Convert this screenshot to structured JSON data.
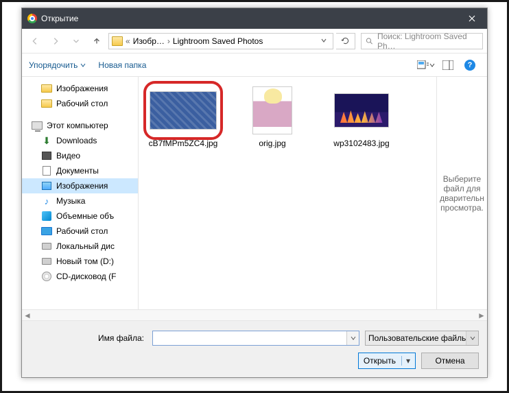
{
  "title": "Открытие",
  "breadcrumb": {
    "parent": "Изобр…",
    "current": "Lightroom Saved Photos"
  },
  "search": {
    "placeholder": "Поиск: Lightroom Saved Ph…"
  },
  "toolbar": {
    "organize": "Упорядочить",
    "newfolder": "Новая папка"
  },
  "sidebar": {
    "items": [
      {
        "label": "Изображения"
      },
      {
        "label": "Рабочий стол"
      },
      {
        "label": "Этот компьютер"
      },
      {
        "label": "Downloads"
      },
      {
        "label": "Видео"
      },
      {
        "label": "Документы"
      },
      {
        "label": "Изображения"
      },
      {
        "label": "Музыка"
      },
      {
        "label": "Объемные объ"
      },
      {
        "label": "Рабочий стол"
      },
      {
        "label": "Локальный дис"
      },
      {
        "label": "Новый том (D:)"
      },
      {
        "label": "CD-дисковод (F"
      }
    ]
  },
  "files": [
    {
      "name": "cB7fMPm5ZC4.jpg"
    },
    {
      "name": "orig.jpg"
    },
    {
      "name": "wp3102483.jpg"
    }
  ],
  "preview_hint": "Выберите файл для дварительн просмотра.",
  "bottom": {
    "filename_label": "Имя файла:",
    "filetype": "Пользовательские файлы (*.jp",
    "open": "Открыть",
    "cancel": "Отмена"
  }
}
